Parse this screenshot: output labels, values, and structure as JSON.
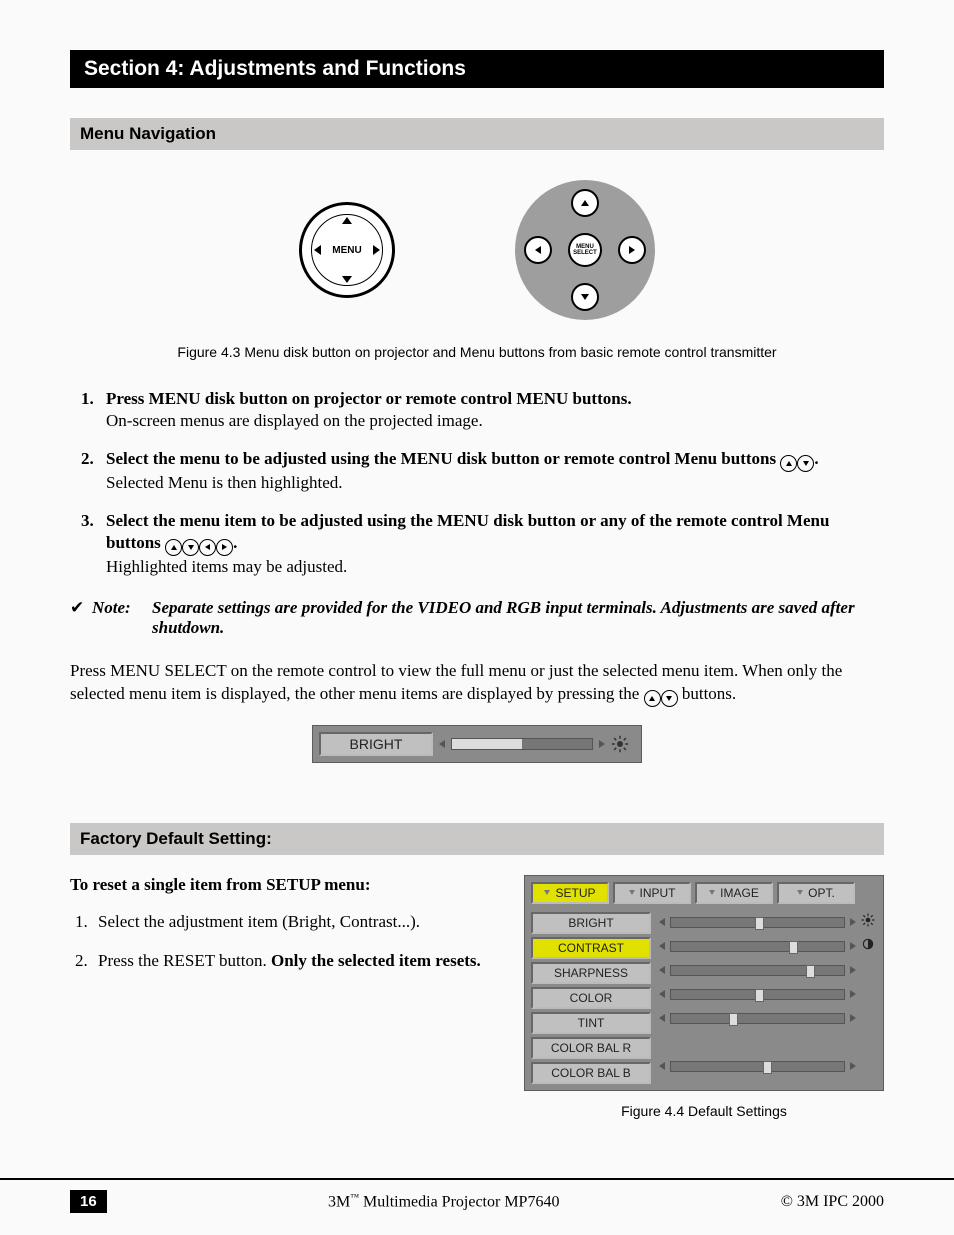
{
  "section_title": "Section 4: Adjustments and Functions",
  "menu_nav_heading": "Menu Navigation",
  "fig43": {
    "disk_label": "MENU",
    "remote_center": "MENU SELECT",
    "caption": "Figure 4.3 Menu disk button on projector and Menu buttons from basic remote control transmitter"
  },
  "steps": {
    "s1_bold": "Press MENU disk button on projector or remote control MENU buttons.",
    "s1_body": "On-screen menus are displayed on the projected image.",
    "s2_bold_a": "Select the menu to be adjusted using the MENU disk button or remote control Menu buttons ",
    "s2_bold_b": ".",
    "s2_body": "Selected Menu is then highlighted.",
    "s3_bold_a": "Select the menu item to be adjusted using the MENU disk button or any of the remote control Menu buttons ",
    "s3_bold_b": ".",
    "s3_body": "Highlighted items may be adjusted."
  },
  "note": {
    "check": "✔",
    "label": "Note:",
    "text": "Separate settings are provided for the VIDEO and RGB input terminals.  Adjustments are saved after shutdown."
  },
  "post_note_a": "Press MENU SELECT on the remote control to view the full menu or just the selected menu item. When only the selected menu item is displayed, the other menu items are displayed by pressing the ",
  "post_note_b": " buttons.",
  "bright_bar_label": "BRIGHT",
  "factory_heading": "Factory Default Setting:",
  "reset_heading": "To reset a single item from SETUP menu:",
  "reset_steps": {
    "r1": "Select the adjustment item (Bright, Contrast...).",
    "r2_a": "Press the RESET button.  ",
    "r2_b": "Only the selected item resets."
  },
  "osd": {
    "tabs": [
      "SETUP",
      "INPUT",
      "IMAGE",
      "OPT."
    ],
    "active_tab_index": 0,
    "items": [
      {
        "label": "BRIGHT",
        "pos": 50,
        "icon": "sun",
        "show_slider": true
      },
      {
        "label": "CONTRAST",
        "pos": 70,
        "icon": "contrast",
        "show_slider": true,
        "active": true
      },
      {
        "label": "SHARPNESS",
        "pos": 80,
        "icon": "",
        "show_slider": true
      },
      {
        "label": "COLOR",
        "pos": 50,
        "icon": "",
        "show_slider": true
      },
      {
        "label": "TINT",
        "pos": 35,
        "icon": "",
        "show_slider": true
      },
      {
        "label": "COLOR BAL R",
        "pos": 0,
        "icon": "",
        "show_slider": false
      },
      {
        "label": "COLOR BAL B",
        "pos": 55,
        "icon": "",
        "show_slider": true
      }
    ],
    "caption": "Figure 4.4 Default Settings"
  },
  "footer": {
    "page": "16",
    "center_a": "3M",
    "center_tm": "™",
    "center_b": " Multimedia Projector MP7640",
    "right": "© 3M IPC 2000"
  }
}
